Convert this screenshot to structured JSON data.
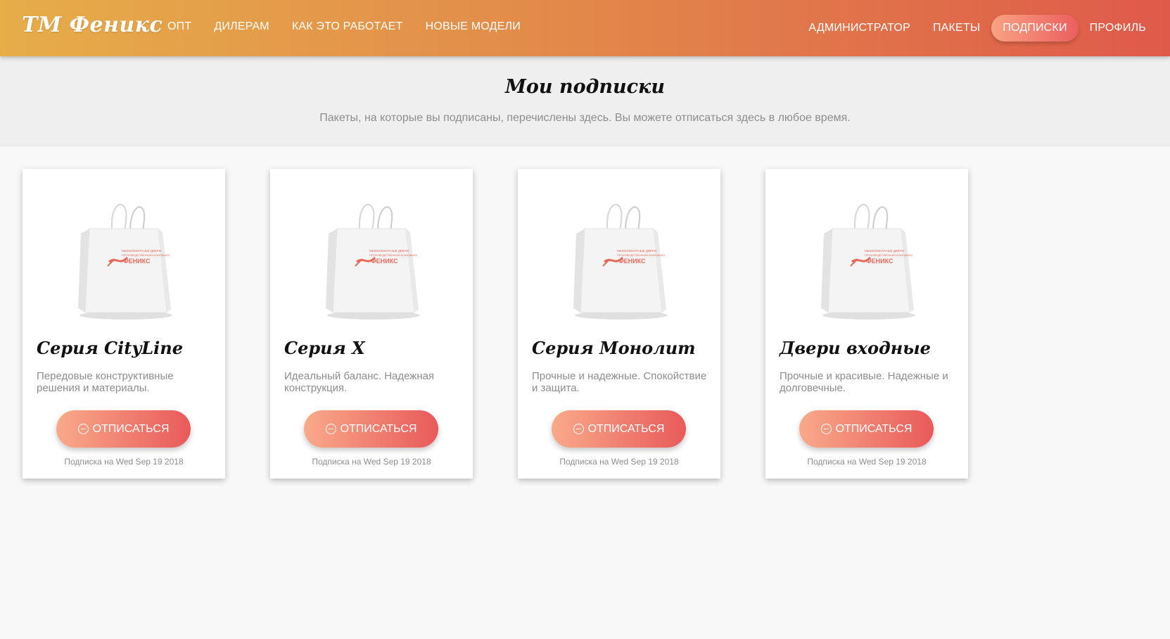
{
  "brand": "ТМ Феникс",
  "nav_left": [
    {
      "label": "ОПТ"
    },
    {
      "label": "ДИЛЕРАМ"
    },
    {
      "label": "КАК ЭТО РАБОТАЕТ"
    },
    {
      "label": "НОВЫЕ МОДЕЛИ"
    }
  ],
  "nav_right": [
    {
      "label": "АДМИНИСТРАТОР"
    },
    {
      "label": "ПАКЕТЫ"
    },
    {
      "label": "ПОДПИСКИ",
      "active": true
    },
    {
      "label": "ПРОФИЛЬ"
    }
  ],
  "header": {
    "title": "Мои подписки",
    "subtitle": "Пакеты, на которые вы подписаны, перечислены здесь. Вы можете отписаться здесь в любое время."
  },
  "cards": [
    {
      "title": "Серия CityLine",
      "description": "Передовые конструктивные решения и материалы.",
      "button_label": "ОТПИСАТЬСЯ",
      "date": "Подписка на Wed Sep 19 2018"
    },
    {
      "title": "Серия X",
      "description": "Идеальный баланс. Надежная конструкция.",
      "button_label": "ОТПИСАТЬСЯ",
      "date": "Подписка на Wed Sep 19 2018"
    },
    {
      "title": "Серия Монолит",
      "description": "Прочные и надежные. Спокойствие и защита.",
      "button_label": "ОТПИСАТЬСЯ",
      "date": "Подписка на Wed Sep 19 2018"
    },
    {
      "title": "Двери входные",
      "description": "Прочные и красивые. Надежные и долговечные.",
      "button_label": "ОТПИСАТЬСЯ",
      "date": "Подписка на Wed Sep 19 2018"
    }
  ],
  "bag_logo": {
    "line1": "МЕЖКОМНАТНЫЕ ДВЕРИ",
    "line2": "ПРОИЗВОДСТВЕННАЯ КОМПАНИЯ",
    "name": "ФЕНИКС",
    "accent": "#e56a5c"
  },
  "colors": {
    "nav_start": "#e6ad49",
    "nav_end": "#df5a4a",
    "button_start": "#f9a98a",
    "button_end": "#e85a5a"
  }
}
